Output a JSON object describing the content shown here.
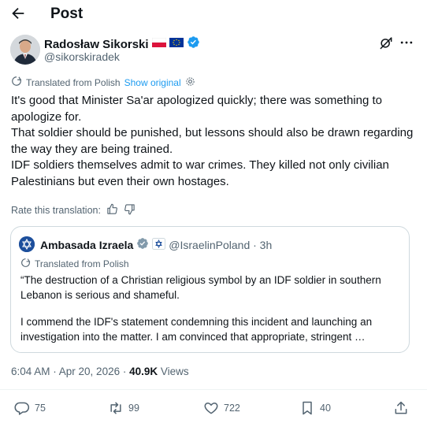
{
  "header": {
    "title": "Post"
  },
  "author": {
    "display_name": "Radosław Sikorski",
    "handle": "@sikorskiradek",
    "flags": [
      "poland-flag",
      "eu-flag"
    ],
    "verified": true
  },
  "translation": {
    "label": "Translated from Polish",
    "show_original": "Show original"
  },
  "post": {
    "paragraphs": [
      "It's good that Minister Sa'ar apologized quickly; there was something to apologize for.",
      "That soldier should be punished, but lessons should also be drawn regarding the way they are being trained.",
      "IDF soldiers themselves admit to war crimes. They killed not only civilian Palestinians but even their own hostages."
    ]
  },
  "rate": {
    "label": "Rate this translation:"
  },
  "quote": {
    "display_name": "Ambasada Izraela",
    "handle_time": "@IsraelinPoland · 3h",
    "translated_label": "Translated from Polish",
    "paragraphs": [
      "“The destruction of a Christian religious symbol by an IDF soldier in southern Lebanon is serious and shameful.",
      "I commend the IDF's statement condemning this incident and launching an investigation into the matter. I am convinced that appropriate, stringent …"
    ]
  },
  "meta": {
    "timestamp": "6:04 AM · Apr 20, 2026 · ",
    "views_count": "40.9K",
    "views_label": " Views"
  },
  "actions": {
    "replies": "75",
    "reposts": "99",
    "likes": "722",
    "bookmarks": "40"
  },
  "colors": {
    "accent": "#1d9bf0",
    "text": "#0f1419",
    "muted": "#536471",
    "border": "#cfd9de"
  }
}
